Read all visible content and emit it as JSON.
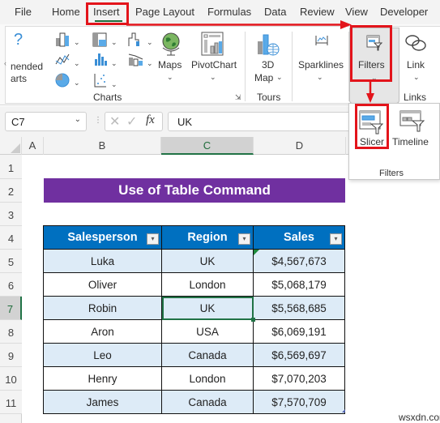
{
  "ribbon_tabs": [
    "File",
    "Home",
    "Insert",
    "Page Layout",
    "Formulas",
    "Data",
    "Review",
    "View",
    "Developer"
  ],
  "active_tab": "Insert",
  "ribbon": {
    "recommended_charts_label": "nended\narts",
    "charts_group_label": "Charts",
    "maps_label": "Maps",
    "pivotchart_label": "PivotChart",
    "map3d_label_line1": "3D",
    "map3d_label_line2": "Map",
    "tours_group_label": "Tours",
    "sparklines_label": "Sparklines",
    "filters_label": "Filters",
    "link_label": "Link",
    "links_group_label": "Links"
  },
  "filters_dropdown": {
    "items": [
      "Slicer",
      "Timeline"
    ],
    "group_label": "Filters",
    "highlighted": "Slicer"
  },
  "formula_bar": {
    "name_box": "C7",
    "formula": "UK",
    "fx_label": "fx"
  },
  "columns": [
    "A",
    "B",
    "C",
    "D"
  ],
  "selected_column": "C",
  "rows": [
    "1",
    "2",
    "3",
    "4",
    "5",
    "6",
    "7",
    "8",
    "9",
    "10",
    "11"
  ],
  "selected_row": "7",
  "sheet": {
    "title": "Use of Table Command",
    "headers": [
      "Salesperson",
      "Region",
      "Sales"
    ],
    "records": [
      [
        "Luka",
        "UK",
        "$4,567,673"
      ],
      [
        "Oliver",
        "London",
        "$5,068,179"
      ],
      [
        "Robin",
        "UK",
        "$5,568,685"
      ],
      [
        "Aron",
        "USA",
        "$6,069,191"
      ],
      [
        "Leo",
        "Canada",
        "$6,569,697"
      ],
      [
        "Henry",
        "London",
        "$7,070,203"
      ],
      [
        "James",
        "Canada",
        "$7,570,709"
      ]
    ]
  },
  "colors": {
    "title_bg": "#7030a0",
    "header_bg": "#0070c0",
    "band_bg": "#ddebf7",
    "highlight_red": "#e3141b",
    "selection_green": "#217346"
  },
  "watermark": "wsxdn.com"
}
